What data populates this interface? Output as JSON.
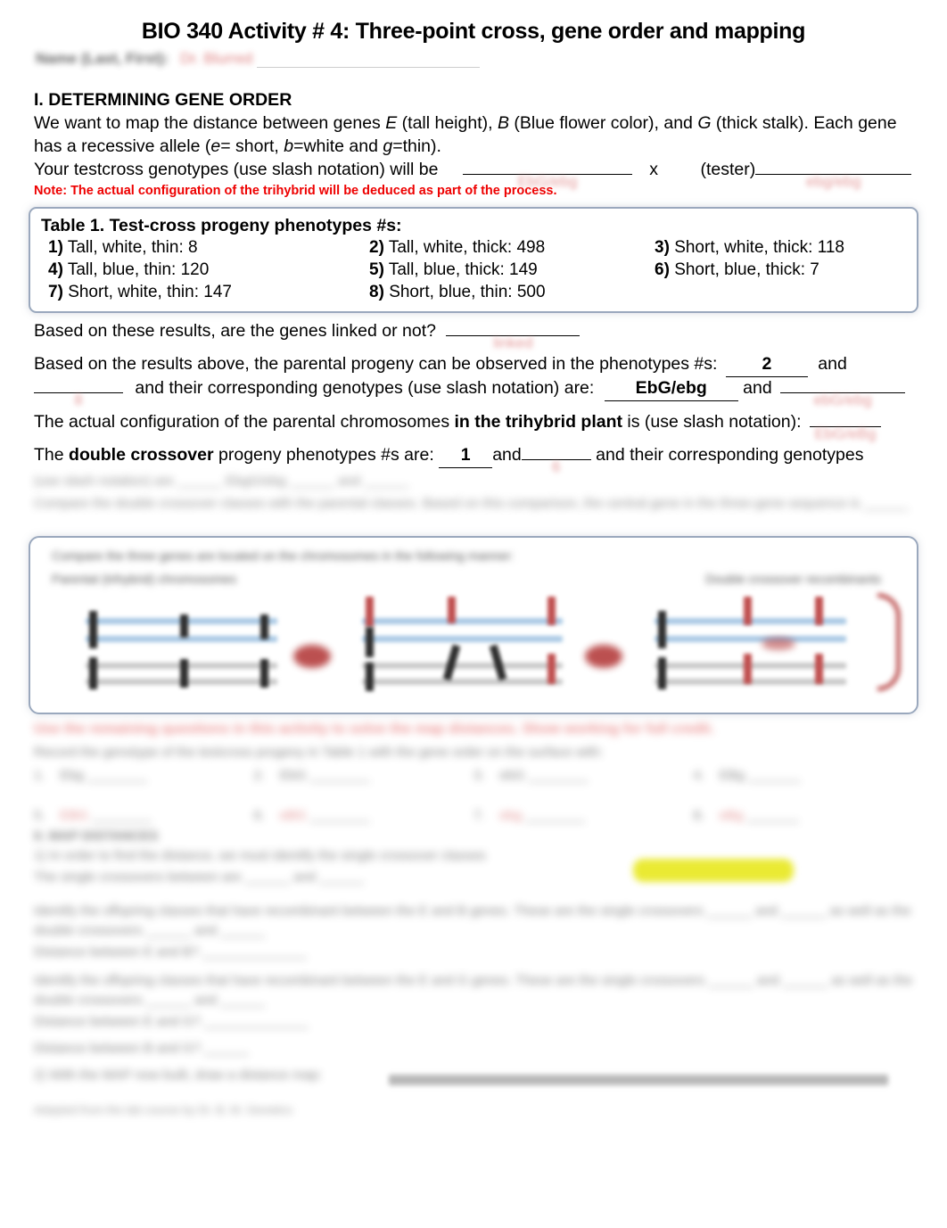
{
  "document": {
    "title": "BIO 340 Activity # 4: Three-point cross, gene order and mapping",
    "name_row": {
      "label_blurred": "Name (Last, First):",
      "answer_blurred": "Dr. Blurred"
    },
    "section_1": {
      "heading": "I. DETERMINING GENE ORDER",
      "paragraph_1_parts": [
        "We want to map the distance between genes ",
        "E",
        " (tall height), ",
        "B",
        " (Blue flower color), and ",
        "G",
        " (thick stalk). Each gene has a recessive allele (",
        "e",
        "= short, ",
        "b",
        "=white and ",
        "g",
        "=thin)."
      ],
      "testcross_line_pre": "Your testcross genotypes (use slash notation) will be",
      "testcross_x": "x",
      "testcross_tester": "(tester)",
      "testcross_answer_1": "EbG/ebg",
      "testcross_answer_2": "ebg/ebg",
      "note": "Note: The actual configuration of the trihybrid will be deduced as part of the process."
    },
    "table1": {
      "caption": "Table 1. Test-cross progeny phenotypes #s:",
      "entries": [
        {
          "num": "1)",
          "phenotype": "Tall, white, thin: 8"
        },
        {
          "num": "2)",
          "phenotype": "Tall, white, thick: 498"
        },
        {
          "num": "3)",
          "phenotype": "Short, white, thick: 118"
        },
        {
          "num": "4)",
          "phenotype": "Tall, blue, thin: 120"
        },
        {
          "num": "5)",
          "phenotype": "Tall, blue, thick: 149"
        },
        {
          "num": "6)",
          "phenotype": "Short, blue, thick: 7"
        },
        {
          "num": "7)",
          "phenotype": "Short, white, thin: 147"
        },
        {
          "num": "8)",
          "phenotype": "Short, blue, thin: 500"
        }
      ]
    },
    "questions": {
      "linked_q": "Based on these results, are the genes linked or not?",
      "linked_answer_blurred": "linked",
      "parental_q_a": "Based on the results above, the parental progeny can be observed in the phenotypes #s:",
      "parental_answer_1": "2",
      "parental_and": "and",
      "parental_answer_2_blurred": "8",
      "parental_q_b": "and their corresponding genotypes (use slash notation) are:",
      "genotype_answer_1": "EbG/ebg",
      "genotype_and": "and",
      "genotype_answer_2_blurred": "ebG/ebg",
      "config_q_pre": "The actual configuration of the parental chromosomes ",
      "config_q_bold": "in the trihybrid plant",
      "config_q_post": " is (use slash notation):",
      "config_answer_blurred": "EbG/eBg",
      "dco_q_pre": "The ",
      "dco_q_bold": "double crossover",
      "dco_q_post": " progeny phenotypes #s are:",
      "dco_answer_1": "1",
      "dco_and": "and",
      "dco_answer_2_blurred": "6",
      "dco_q_tail": "and their corresponding genotypes"
    },
    "redacted_blocks": {
      "line_after_dco": "(use slash notation) are ______ EbgG/ebg ______ and ______",
      "compare_line": "Compare the double crossover classes with the parental classes. Based on this comparison, the central gene in the three-gene sequence is ______",
      "diagram_caption_1": "Compare the three genes are located on the chromosomes in the following manner:",
      "diagram_caption_2": "Parental (trihybrid) chromosomes",
      "diagram_caption_3": "Double crossover recombinants",
      "red_instruction": "Use the remaining questions in this activity to solve the map distances. Show working for full credit.",
      "record_line": "Record the genotype of the testcross progeny in Table 1 with the gene order on the surface with:",
      "section_2_heading": "II. MAP DISTANCES",
      "map_intro": "1) In order to find the distance, we must identify the single crossover classes",
      "map_highlight": "(highlighted)",
      "map_line2": "The single crossovers between are ______ and ______",
      "map_q1": "Identify the offspring classes that have recombinant between the E and B genes. These are the single crossovers ______ and ______ as well as the double crossovers ______ and ______",
      "map_ans1": "Distance between E and B? ______________",
      "map_q2": "Identify the offspring classes that have recombinant between the E and G genes. These are the single crossovers ______ and ______ as well as the double crossovers ______ and ______",
      "map_ans2": "Distance between E and G? ______________",
      "map_ans3": "Distance between B and G? ______",
      "final_line": "2) With the MAP now built, draw a distance map:",
      "credit_line": "Adapted from the lab course by Dr. B. M. Genetics"
    }
  },
  "colors": {
    "note_red": "#ee0000",
    "box_border": "#9aa8bd",
    "highlight_yellow": "#e8e81e",
    "diagram_red": "#b03232",
    "diagram_blue": "#a8c8e4",
    "ink_red": "#d86a6a"
  }
}
